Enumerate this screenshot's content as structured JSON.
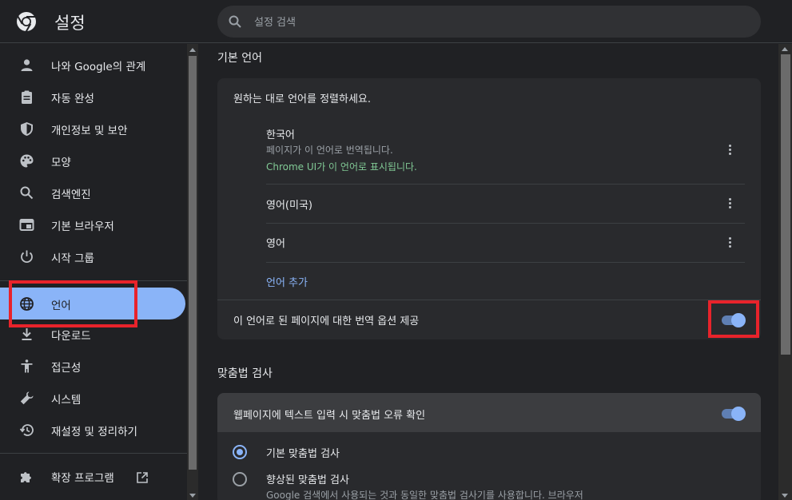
{
  "header": {
    "title": "설정",
    "search_placeholder": "설정 검색"
  },
  "sidebar": {
    "items": [
      {
        "label": "나와 Google의 관계",
        "icon": "person-icon"
      },
      {
        "label": "자동 완성",
        "icon": "clipboard-icon"
      },
      {
        "label": "개인정보 및 보안",
        "icon": "shield-icon"
      },
      {
        "label": "모양",
        "icon": "palette-icon"
      },
      {
        "label": "검색엔진",
        "icon": "search-icon"
      },
      {
        "label": "기본 브라우저",
        "icon": "browser-window-icon"
      },
      {
        "label": "시작 그룹",
        "icon": "power-icon"
      },
      {
        "label": "언어",
        "icon": "globe-icon",
        "active": true
      },
      {
        "label": "다운로드",
        "icon": "download-icon"
      },
      {
        "label": "접근성",
        "icon": "accessibility-icon"
      },
      {
        "label": "시스템",
        "icon": "wrench-icon"
      },
      {
        "label": "재설정 및 정리하기",
        "icon": "history-icon"
      }
    ],
    "extensions_label": "확장 프로그램"
  },
  "language_section": {
    "title": "기본 언어",
    "instruction": "원하는 대로 언어를 정렬하세요.",
    "languages": [
      {
        "name": "한국어",
        "note": "페이지가 이 언어로 번역됩니다.",
        "ui_note": "Chrome UI가 이 언어로 표시됩니다."
      },
      {
        "name": "영어(미국)"
      },
      {
        "name": "영어"
      }
    ],
    "add_language": "언어 추가",
    "translate_option": "이 언어로 된 페이지에 대한 번역 옵션 제공",
    "translate_enabled": true
  },
  "spell_section": {
    "title": "맞춤법 검사",
    "check_label": "웹페이지에 텍스트 입력 시 맞춤법 오류 확인",
    "check_enabled": true,
    "basic_option": "기본 맞춤법 검사",
    "enhanced_option": "향상된 맞춤법 검사",
    "enhanced_desc": "Google 검색에서 사용되는 것과 동일한 맞춤법 검사기를 사용합니다. 브라우저",
    "selected": "basic"
  },
  "colors": {
    "accent": "#8ab4f8",
    "highlight_box": "#e8232b",
    "green_text": "#81c995"
  }
}
